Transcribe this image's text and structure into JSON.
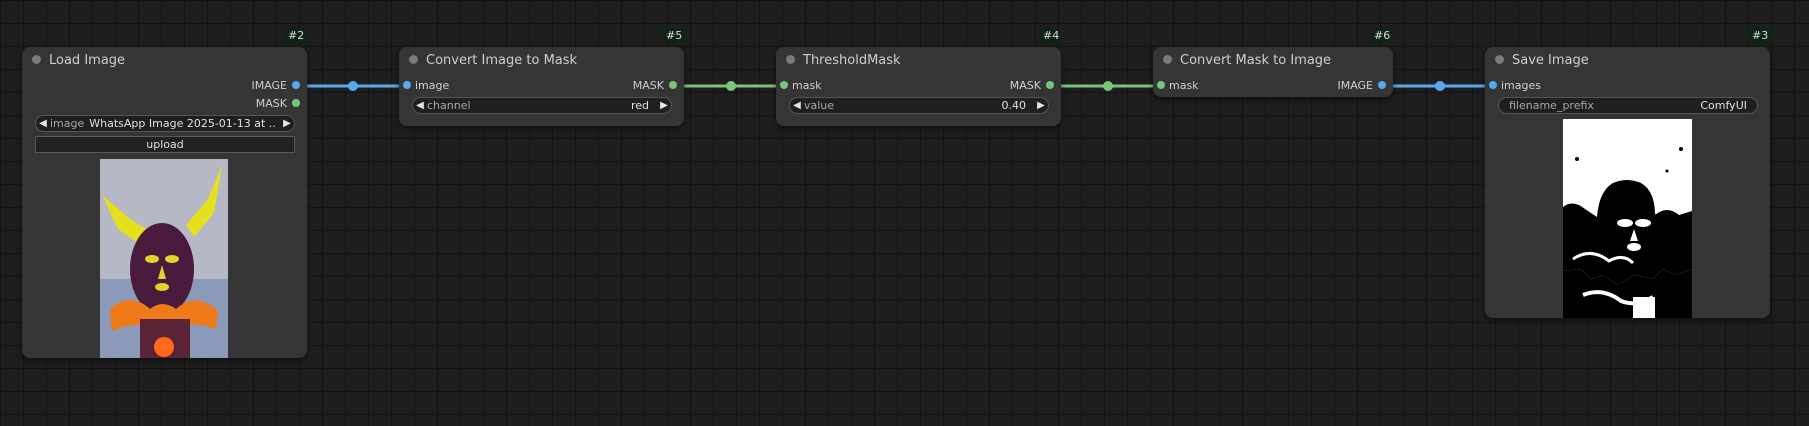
{
  "nodes": {
    "load_image": {
      "id": "#2",
      "title": "Load Image",
      "outputs": [
        "IMAGE",
        "MASK"
      ],
      "image_widget": {
        "label": "image",
        "value": "WhatsApp Image 2025-01-13 at ..."
      },
      "upload_label": "upload"
    },
    "image_to_mask": {
      "id": "#5",
      "title": "Convert Image to Mask",
      "input": "image",
      "output": "MASK",
      "channel_widget": {
        "label": "channel",
        "value": "red"
      }
    },
    "threshold_mask": {
      "id": "#4",
      "title": "ThresholdMask",
      "input": "mask",
      "output": "MASK",
      "value_widget": {
        "label": "value",
        "value": "0.40"
      }
    },
    "mask_to_image": {
      "id": "#6",
      "title": "Convert Mask to Image",
      "input": "mask",
      "output": "IMAGE"
    },
    "save_image": {
      "id": "#3",
      "title": "Save Image",
      "input": "images",
      "prefix_widget": {
        "label": "filename_prefix",
        "value": "ComfyUI"
      }
    }
  },
  "colors": {
    "image_link": "#5aa9ef",
    "mask_link": "#7bc47b",
    "node_bg": "#353535",
    "canvas_bg": "#1e1e1e"
  }
}
